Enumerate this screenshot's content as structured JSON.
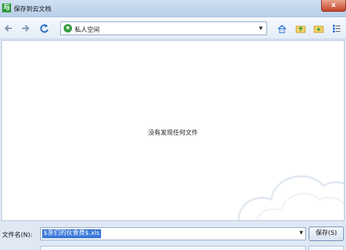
{
  "window": {
    "title": "保存到云文档",
    "app_icon_glyph": "与",
    "close_glyph": "x"
  },
  "toolbar": {
    "back_icon": "back-arrow-icon",
    "forward_icon": "forward-arrow-icon",
    "refresh_icon": "refresh-icon",
    "location": "私人空间",
    "location_icon": "user-space-icon",
    "home_icon": "home-icon",
    "up_icon": "up-folder-icon",
    "new_folder_icon": "new-folder-icon",
    "view_icon": "view-list-icon"
  },
  "main": {
    "empty_message": "没有发现任何文件"
  },
  "bottom": {
    "filename_label": "文件名(N):",
    "filename_value": "$亲们的伙食费$.xls",
    "save_label": "保存(S)"
  },
  "colors": {
    "accent": "#3b78d8",
    "app_icon": "#2e9a3d",
    "close": "#c8432a"
  }
}
